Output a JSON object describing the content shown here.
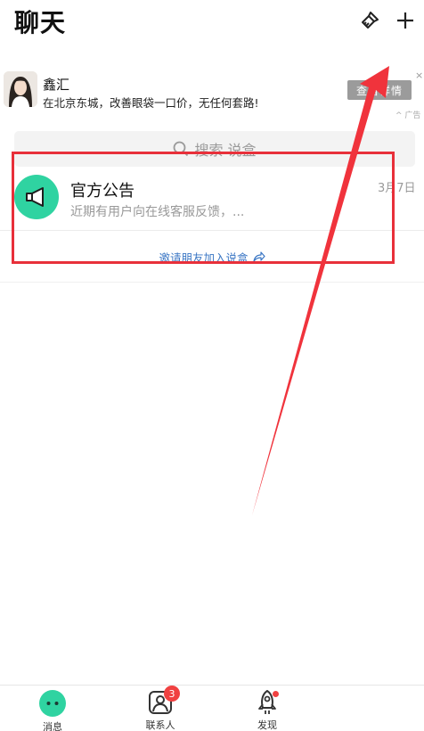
{
  "header": {
    "title": "聊天"
  },
  "ad": {
    "name": "鑫汇",
    "text": "在北京东城，改善眼袋一口价，无任何套路!",
    "button_label": "查看详情",
    "close_label": "×",
    "tag": "^ 广告"
  },
  "search": {
    "placeholder": "搜索 说盒"
  },
  "notice": {
    "title": "官方公告",
    "preview": "近期有用户向在线客服反馈，...",
    "date": "3月7日"
  },
  "invite": {
    "label": "邀请朋友加入说盒"
  },
  "tabbar": {
    "items": [
      {
        "label": "消息",
        "icon": "chat-bubble-icon",
        "active": true
      },
      {
        "label": "联系人",
        "icon": "contacts-icon",
        "badge": "3"
      },
      {
        "label": "发现",
        "icon": "rocket-icon",
        "dot": true
      }
    ]
  },
  "colors": {
    "accent": "#2fd3a1",
    "annotation": "#e8303a",
    "badge": "#f04141",
    "link": "#3a76c4"
  }
}
